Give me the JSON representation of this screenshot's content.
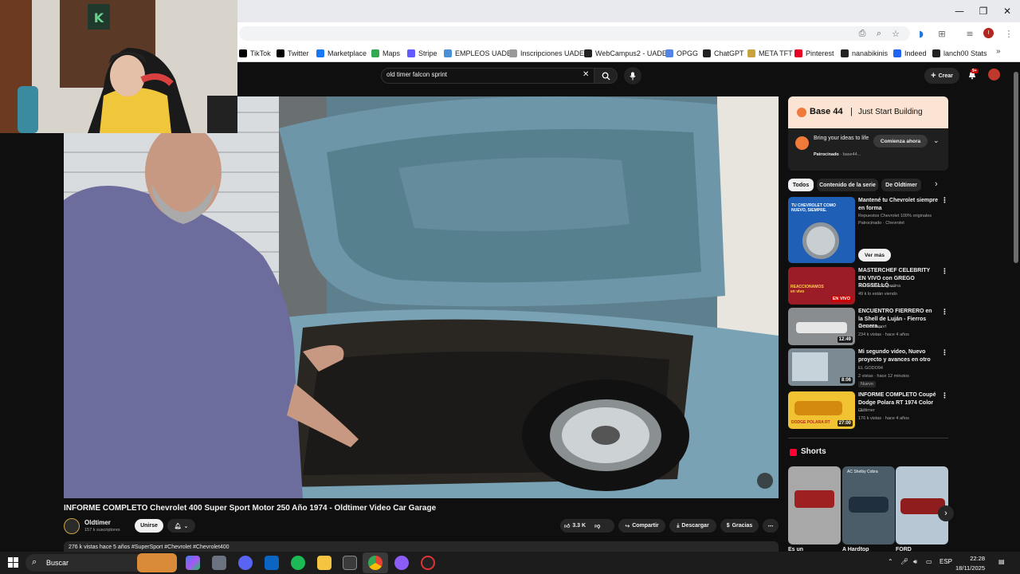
{
  "browser": {
    "win_minimize": "—",
    "win_restore": "❐",
    "win_close": "✕",
    "bookmarks": [
      {
        "label": "TikTok",
        "color": "#000000"
      },
      {
        "label": "Twitter",
        "color": "#000000"
      },
      {
        "label": "Marketplace",
        "color": "#1877f2"
      },
      {
        "label": "Maps",
        "color": "#34a853"
      },
      {
        "label": "Stripe",
        "color": "#635bff"
      },
      {
        "label": "EMPLEOS UADE",
        "color": "#4a90d9"
      },
      {
        "label": "Inscripciones UADE",
        "color": "#999999"
      },
      {
        "label": "WebCampus2 - UADE",
        "color": "#222222"
      },
      {
        "label": "OPGG",
        "color": "#5383e8"
      },
      {
        "label": "ChatGPT",
        "color": "#222222"
      },
      {
        "label": "META TFT",
        "color": "#c8a33d"
      },
      {
        "label": "Pinterest",
        "color": "#e60023"
      },
      {
        "label": "nanabikinis",
        "color": "#222222"
      },
      {
        "label": "Indeed",
        "color": "#2164f3"
      },
      {
        "label": "lanch00 Stats",
        "color": "#222222"
      }
    ],
    "bookmarks_more": "»"
  },
  "youtube": {
    "search_query": "old timer falcon sprint",
    "create_label": "Crear",
    "notif_count": "9+",
    "video_title": "INFORME COMPLETO Chevrolet 400 Super Sport Motor 250 Año 1974 - Oldtimer Video Car Garage",
    "channel_name": "Oldtimer",
    "channel_subs": "157 k suscriptores",
    "join_label": "Unirse",
    "likes": "3.3 K",
    "share_label": "Compartir",
    "download_label": "Descargar",
    "thanks_label": "Gracias",
    "description": "276 k vistas  hace 5 años  #SuperSport #Chevrolet #Chevrolet400",
    "ad": {
      "brand": "Base 44",
      "tagline": "Just Start Building",
      "headline": "Bring your ideas to life",
      "sponsor": "Patrocinado",
      "domain": "base44...",
      "cta": "Comienza ahora"
    },
    "filters": [
      "Todos",
      "Contenido de la serie",
      "De Oldtimer"
    ],
    "recommendations": [
      {
        "title": "Mantené tu Chevrolet siempre en forma",
        "channel": "Repuestos Chevrolet 100% originales",
        "meta": "Patrocinado · Chevrolet",
        "cta": "Ver más",
        "thumb_text": "TU CHEVROLET COMO NUEVO, SIEMPRE."
      },
      {
        "title": "MASTERCHEF CELEBRITY EN VIVO con GREGO ROSSELLÓ ...",
        "channel": "MasterChef Argentina",
        "meta": "49 k lo están viendo",
        "badge": "EN VIVO",
        "thumb_text": "REACCIONAMOS en vivo"
      },
      {
        "title": "ENCUENTRO FIERRERO en la Shell de Luján - Fierros Genera...",
        "channel": "RK Motorsport",
        "meta": "234 k vistas · hace 4 años",
        "duration": "12:49"
      },
      {
        "title": "Mi segundo video, Nuevo proyecto y avances en otro",
        "channel": "EL GODO94",
        "meta": "2 vistas · hace 12 minutos",
        "badge": "Nuevo",
        "duration": "8:06"
      },
      {
        "title": "INFORME COMPLETO Coupé Dodge Polara RT 1974 Color ...",
        "channel": "Oldtimer",
        "meta": "176 k vistas · hace 4 años",
        "duration": "27:00",
        "thumb_text": "DODGE POLARA RT"
      }
    ],
    "shorts_title": "Shorts",
    "shorts": [
      {
        "title": "Es un"
      },
      {
        "title": "A Hardtop",
        "thumb_text": "AC Shelby Cobra"
      },
      {
        "title": "FORD"
      }
    ]
  },
  "taskbar": {
    "search_placeholder": "Buscar",
    "lang": "ESP",
    "time": "22:28",
    "date": "18/11/2025"
  }
}
